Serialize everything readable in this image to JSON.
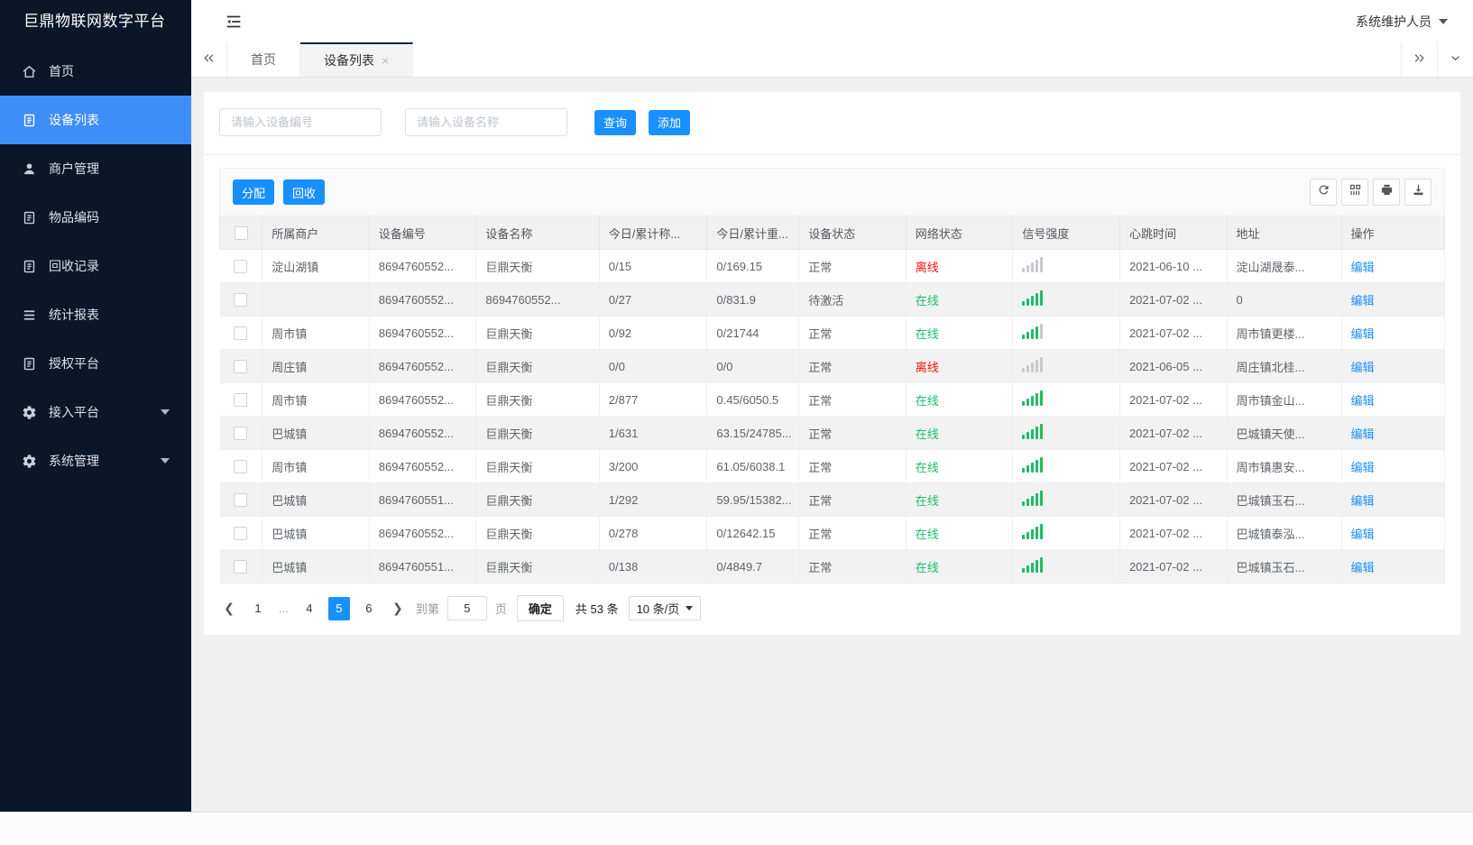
{
  "app": {
    "title": "巨鼎物联网数字平台",
    "user_name": "系统维护人员"
  },
  "sidebar": {
    "items": [
      {
        "label": "首页",
        "icon": "home",
        "active": false,
        "expandable": false
      },
      {
        "label": "设备列表",
        "icon": "doc",
        "active": true,
        "expandable": false
      },
      {
        "label": "商户管理",
        "icon": "user",
        "active": false,
        "expandable": false
      },
      {
        "label": "物品编码",
        "icon": "doc",
        "active": false,
        "expandable": false
      },
      {
        "label": "回收记录",
        "icon": "doc",
        "active": false,
        "expandable": false
      },
      {
        "label": "统计报表",
        "icon": "stats",
        "active": false,
        "expandable": false
      },
      {
        "label": "授权平台",
        "icon": "doc",
        "active": false,
        "expandable": false
      },
      {
        "label": "接入平台",
        "icon": "gear",
        "active": false,
        "expandable": true
      },
      {
        "label": "系统管理",
        "icon": "gear",
        "active": false,
        "expandable": true
      }
    ]
  },
  "tabs": {
    "items": [
      {
        "label": "首页",
        "active": false,
        "closable": false
      },
      {
        "label": "设备列表",
        "active": true,
        "closable": true
      }
    ]
  },
  "search": {
    "device_no_placeholder": "请输入设备编号",
    "device_name_placeholder": "请输入设备名称",
    "query_label": "查询",
    "add_label": "添加"
  },
  "toolbar": {
    "assign_label": "分配",
    "recycle_label": "回收",
    "icons": [
      "refresh",
      "columns",
      "print",
      "export"
    ]
  },
  "table": {
    "columns": [
      "所属商户",
      "设备编号",
      "设备名称",
      "今日/累计称...",
      "今日/累计重...",
      "设备状态",
      "网络状态",
      "信号强度",
      "心跳时间",
      "地址",
      "操作"
    ],
    "rows": [
      {
        "merchant": "淀山湖镇",
        "device_no": "8694760552...",
        "device_name": "巨鼎天衡",
        "today_count": "0/15",
        "today_weight": "0/169.15",
        "device_status": "正常",
        "network_status": "离线",
        "online": false,
        "signal_bars": 0,
        "heartbeat": "2021-06-10 ...",
        "address": "淀山湖晟泰...",
        "action": "编辑"
      },
      {
        "merchant": "",
        "device_no": "8694760552...",
        "device_name": "8694760552...",
        "today_count": "0/27",
        "today_weight": "0/831.9",
        "device_status": "待激活",
        "network_status": "在线",
        "online": true,
        "signal_bars": 5,
        "heartbeat": "2021-07-02 ...",
        "address": "0",
        "action": "编辑"
      },
      {
        "merchant": "周市镇",
        "device_no": "8694760552...",
        "device_name": "巨鼎天衡",
        "today_count": "0/92",
        "today_weight": "0/21744",
        "device_status": "正常",
        "network_status": "在线",
        "online": true,
        "signal_bars": 4,
        "heartbeat": "2021-07-02 ...",
        "address": "周市镇更楼...",
        "action": "编辑"
      },
      {
        "merchant": "周庄镇",
        "device_no": "8694760552...",
        "device_name": "巨鼎天衡",
        "today_count": "0/0",
        "today_weight": "0/0",
        "device_status": "正常",
        "network_status": "离线",
        "online": false,
        "signal_bars": 0,
        "heartbeat": "2021-06-05 ...",
        "address": "周庄镇北桂...",
        "action": "编辑"
      },
      {
        "merchant": "周市镇",
        "device_no": "8694760552...",
        "device_name": "巨鼎天衡",
        "today_count": "2/877",
        "today_weight": "0.45/6050.5",
        "device_status": "正常",
        "network_status": "在线",
        "online": true,
        "signal_bars": 5,
        "heartbeat": "2021-07-02 ...",
        "address": "周市镇金山...",
        "action": "编辑"
      },
      {
        "merchant": "巴城镇",
        "device_no": "8694760552...",
        "device_name": "巨鼎天衡",
        "today_count": "1/631",
        "today_weight": "63.15/24785...",
        "device_status": "正常",
        "network_status": "在线",
        "online": true,
        "signal_bars": 5,
        "heartbeat": "2021-07-02 ...",
        "address": "巴城镇天使...",
        "action": "编辑"
      },
      {
        "merchant": "周市镇",
        "device_no": "8694760552...",
        "device_name": "巨鼎天衡",
        "today_count": "3/200",
        "today_weight": "61.05/6038.1",
        "device_status": "正常",
        "network_status": "在线",
        "online": true,
        "signal_bars": 5,
        "heartbeat": "2021-07-02 ...",
        "address": "周市镇惠安...",
        "action": "编辑"
      },
      {
        "merchant": "巴城镇",
        "device_no": "8694760551...",
        "device_name": "巨鼎天衡",
        "today_count": "1/292",
        "today_weight": "59.95/15382...",
        "device_status": "正常",
        "network_status": "在线",
        "online": true,
        "signal_bars": 5,
        "heartbeat": "2021-07-02 ...",
        "address": "巴城镇玉石...",
        "action": "编辑"
      },
      {
        "merchant": "巴城镇",
        "device_no": "8694760552...",
        "device_name": "巨鼎天衡",
        "today_count": "0/278",
        "today_weight": "0/12642.15",
        "device_status": "正常",
        "network_status": "在线",
        "online": true,
        "signal_bars": 5,
        "heartbeat": "2021-07-02 ...",
        "address": "巴城镇泰泓...",
        "action": "编辑"
      },
      {
        "merchant": "巴城镇",
        "device_no": "8694760551...",
        "device_name": "巨鼎天衡",
        "today_count": "0/138",
        "today_weight": "0/4849.7",
        "device_status": "正常",
        "network_status": "在线",
        "online": true,
        "signal_bars": 5,
        "heartbeat": "2021-07-02 ...",
        "address": "巴城镇玉石...",
        "action": "编辑"
      }
    ]
  },
  "pagination": {
    "pages": [
      "1",
      "...",
      "4",
      "5",
      "6"
    ],
    "active_page": "5",
    "goto_label": "到第",
    "goto_value": "5",
    "page_unit": "页",
    "confirm_label": "确定",
    "total_label": "共 53 条",
    "page_size": "10 条/页"
  },
  "colors": {
    "primary": "#1890ff",
    "sidebar_active": "#3e8ef7",
    "online_green": "#19be6b",
    "offline_red": "#f50f0f",
    "sidebar_bg": "#0b1628"
  }
}
